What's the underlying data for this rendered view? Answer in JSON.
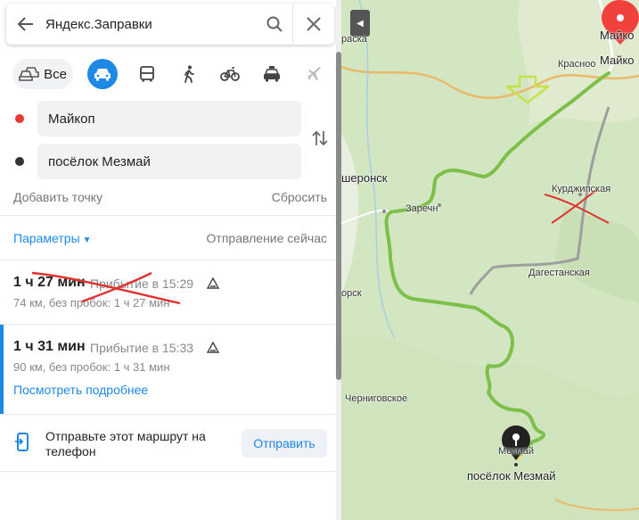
{
  "search": {
    "query": "Яндекс.Заправки"
  },
  "modes": {
    "all_label": "Все",
    "items": [
      "car-icon",
      "bus-icon",
      "walk-icon",
      "bike-icon",
      "taxi-icon",
      "plane-icon"
    ],
    "active": "car",
    "accent": "#1e88e5"
  },
  "route_points": {
    "from": "Майкоп",
    "to": "посёлок Мезмай"
  },
  "actions": {
    "add_point": "Добавить точку",
    "reset": "Сбросить",
    "params": "Параметры",
    "depart": "Отправление сейчас"
  },
  "routes": [
    {
      "time": "1 ч 27 мин",
      "arrival": "Прибытие в 15:29",
      "distance": "74 км, без пробок: 1 ч 27 мин",
      "crossed_out": true
    },
    {
      "time": "1 ч 31 мин",
      "arrival": "Прибытие в 15:33",
      "distance": "90 км, без пробок: 1 ч 31 мин",
      "details_link": "Посмотреть подробнее",
      "selected": true
    }
  ],
  "send": {
    "text": "Отправьте этот маршрут на телефон",
    "button": "Отправить"
  },
  "map": {
    "labels": {
      "maykop_top": "Майко",
      "maykop": "Майко",
      "krasnooktyabrsky": "Красноо",
      "kraska": "раска",
      "apsheronsk": "шеронск",
      "zarechny": "Заречн",
      "kurdzhipskaya": "Курджипская",
      "dagestanskaya": "Дагестанская",
      "orsk": "орск",
      "chernigovskoe": "Черниговское",
      "mezmay_small": "Мезмай",
      "mezmay": "посёлок Мезмай"
    }
  }
}
